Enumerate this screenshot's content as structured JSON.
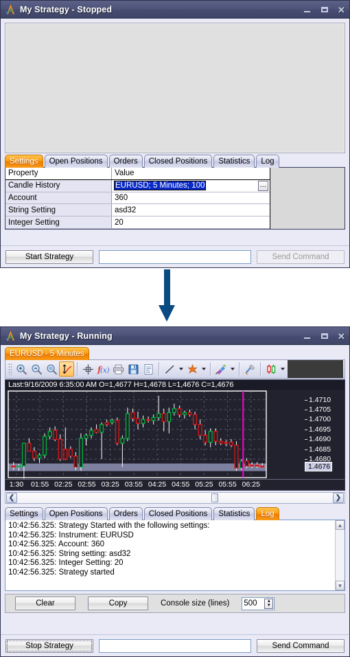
{
  "stopped_window": {
    "title_app": "My Strategy",
    "title_status": " - Stopped",
    "logo_icon": "alpari-a-logo-icon",
    "window_controls": {
      "minimize": "minimize-icon",
      "maximize": "maximize-icon",
      "close": "✕"
    },
    "tabs": [
      {
        "label": "Settings",
        "active": true
      },
      {
        "label": "Open Positions",
        "active": false
      },
      {
        "label": "Orders",
        "active": false
      },
      {
        "label": "Closed Positions",
        "active": false
      },
      {
        "label": "Statistics",
        "active": false
      },
      {
        "label": "Log",
        "active": false
      }
    ],
    "grid": {
      "columns": [
        "Property",
        "Value"
      ],
      "rows": [
        {
          "property": "Candle History",
          "value": "EURUSD; 5 Minutes; 100",
          "selected": true,
          "has_ellipsis": true,
          "ellipsis_label": "…"
        },
        {
          "property": "Account",
          "value": "360",
          "selected": false,
          "has_ellipsis": false
        },
        {
          "property": "String Setting",
          "value": "asd32",
          "selected": false,
          "has_ellipsis": false
        },
        {
          "property": "Integer Setting",
          "value": "20",
          "selected": false,
          "has_ellipsis": false
        }
      ]
    },
    "command_bar": {
      "action_button": "Start Strategy",
      "input_value": "",
      "input_placeholder": "",
      "send_button": "Send Command"
    }
  },
  "arrow": {
    "name": "flow-arrow-down",
    "color": "#0a4a82"
  },
  "running_window": {
    "title_app": "My Strategy",
    "title_status": " - Running",
    "logo_icon": "alpari-a-logo-icon",
    "chart_tab": {
      "label": "EURUSD - 5 Minutes",
      "active": true
    },
    "toolbar": {
      "buttons": [
        {
          "name": "zoom-in-icon",
          "caret": false
        },
        {
          "name": "zoom-out-icon",
          "caret": false
        },
        {
          "name": "zoom-fit-icon",
          "caret": false
        },
        {
          "name": "auto-scale-icon",
          "caret": false,
          "active": true
        },
        {
          "name": "crosshair-icon",
          "caret": false
        },
        {
          "name": "indicator-fx-icon",
          "caret": false
        },
        {
          "name": "print-icon",
          "caret": false
        },
        {
          "name": "save-icon",
          "caret": false
        },
        {
          "name": "report-icon",
          "caret": false
        },
        {
          "name": "line-tool-icon",
          "caret": true
        },
        {
          "name": "delete-objects-icon",
          "caret": true
        },
        {
          "name": "color-scheme-icon",
          "caret": true
        },
        {
          "name": "chart-settings-icon",
          "caret": false
        },
        {
          "name": "candle-type-icon",
          "caret": true
        }
      ]
    },
    "chart_info": "Last:9/16/2009 6:35:00 AM O=1,4677 H=1,4678 L=1,4676 C=1,4676",
    "scrollbar": {
      "left_arrow": "❮",
      "right_arrow": "❯"
    },
    "tabs": [
      {
        "label": "Settings",
        "active": false
      },
      {
        "label": "Open Positions",
        "active": false
      },
      {
        "label": "Orders",
        "active": false
      },
      {
        "label": "Closed Positions",
        "active": false
      },
      {
        "label": "Statistics",
        "active": false
      },
      {
        "label": "Log",
        "active": true
      }
    ],
    "log_lines": [
      "10:42:56.325: Strategy Started with the following settings:",
      "10:42:56.325: Instrument: EURUSD",
      "10:42:56.325: Account: 360",
      "10:42:56.325: String setting: asd32",
      "10:42:56.325: Integer Setting: 20",
      "10:42:56.325: Strategy started"
    ],
    "console_bar": {
      "clear_button": "Clear",
      "copy_button": "Copy",
      "console_size_label": "Console size (lines)",
      "console_size_value": "500",
      "spin_up": "▲",
      "spin_down": "▼"
    },
    "command_bar": {
      "action_button": "Stop Strategy",
      "input_value": "",
      "input_placeholder": "",
      "send_button": "Send Command"
    }
  },
  "chart_data": {
    "type": "candlestick",
    "title": "EURUSD - 5 Minutes",
    "instrument": "EURUSD",
    "timeframe": "5 Minutes",
    "xlabel": "",
    "ylabel": "",
    "grid": true,
    "legend_position": "none",
    "background": "#22222e",
    "up_color": "#00b33c",
    "down_color": "#e01515",
    "wick_color": "#ffffff",
    "cursor_line_color": "#ff00d0",
    "current_price": 1.4676,
    "ylim": [
      1.4672,
      1.4713
    ],
    "price_ticks": [
      1.471,
      1.4705,
      1.47,
      1.4695,
      1.469,
      1.4685,
      1.468
    ],
    "time_ticks": [
      "1:30",
      "01:55",
      "02:25",
      "02:55",
      "03:25",
      "03:55",
      "04:25",
      "04:55",
      "05:25",
      "05:55",
      "06:25"
    ],
    "last_quote": {
      "date": "9/16/2009",
      "time": "6:35:00 AM",
      "open": 1.4677,
      "high": 1.4678,
      "low": 1.4676,
      "close": 1.4676
    },
    "candles": [
      {
        "o": 1.46765,
        "h": 1.46785,
        "l": 1.46745,
        "c": 1.4676,
        "dir": "down"
      },
      {
        "o": 1.4676,
        "h": 1.46775,
        "l": 1.4674,
        "c": 1.46765,
        "dir": "up"
      },
      {
        "o": 1.46765,
        "h": 1.4679,
        "l": 1.467,
        "c": 1.4688,
        "dir": "up"
      },
      {
        "o": 1.4688,
        "h": 1.46905,
        "l": 1.46855,
        "c": 1.4684,
        "dir": "down"
      },
      {
        "o": 1.4684,
        "h": 1.4686,
        "l": 1.4679,
        "c": 1.46805,
        "dir": "down"
      },
      {
        "o": 1.46805,
        "h": 1.4683,
        "l": 1.4678,
        "c": 1.4682,
        "dir": "up"
      },
      {
        "o": 1.4682,
        "h": 1.4693,
        "l": 1.46805,
        "c": 1.46915,
        "dir": "up"
      },
      {
        "o": 1.46915,
        "h": 1.4696,
        "l": 1.469,
        "c": 1.4694,
        "dir": "up"
      },
      {
        "o": 1.46945,
        "h": 1.46965,
        "l": 1.4689,
        "c": 1.469,
        "dir": "down"
      },
      {
        "o": 1.469,
        "h": 1.46925,
        "l": 1.4679,
        "c": 1.468,
        "dir": "down"
      },
      {
        "o": 1.468,
        "h": 1.4696,
        "l": 1.46795,
        "c": 1.4685,
        "dir": "down"
      },
      {
        "o": 1.4685,
        "h": 1.46865,
        "l": 1.46805,
        "c": 1.46815,
        "dir": "down"
      },
      {
        "o": 1.46815,
        "h": 1.46835,
        "l": 1.46745,
        "c": 1.4676,
        "dir": "down"
      },
      {
        "o": 1.4676,
        "h": 1.4693,
        "l": 1.4674,
        "c": 1.46905,
        "dir": "up"
      },
      {
        "o": 1.46905,
        "h": 1.4693,
        "l": 1.4687,
        "c": 1.4692,
        "dir": "up"
      },
      {
        "o": 1.4692,
        "h": 1.4696,
        "l": 1.46905,
        "c": 1.46945,
        "dir": "up"
      },
      {
        "o": 1.4695,
        "h": 1.46975,
        "l": 1.4693,
        "c": 1.46935,
        "dir": "down"
      },
      {
        "o": 1.46935,
        "h": 1.46985,
        "l": 1.468,
        "c": 1.46975,
        "dir": "up"
      },
      {
        "o": 1.46975,
        "h": 1.47,
        "l": 1.46965,
        "c": 1.46985,
        "dir": "down"
      },
      {
        "o": 1.46985,
        "h": 1.47005,
        "l": 1.46975,
        "c": 1.46995,
        "dir": "up"
      },
      {
        "o": 1.46995,
        "h": 1.4701,
        "l": 1.4687,
        "c": 1.4688,
        "dir": "down"
      },
      {
        "o": 1.4688,
        "h": 1.4692,
        "l": 1.4676,
        "c": 1.46905,
        "dir": "up"
      },
      {
        "o": 1.46905,
        "h": 1.4706,
        "l": 1.4689,
        "c": 1.4703,
        "dir": "up"
      },
      {
        "o": 1.47035,
        "h": 1.47055,
        "l": 1.4699,
        "c": 1.47005,
        "dir": "down"
      },
      {
        "o": 1.47005,
        "h": 1.4704,
        "l": 1.4695,
        "c": 1.4698,
        "dir": "down"
      },
      {
        "o": 1.4698,
        "h": 1.4702,
        "l": 1.4696,
        "c": 1.47,
        "dir": "up"
      },
      {
        "o": 1.47,
        "h": 1.47015,
        "l": 1.46985,
        "c": 1.46995,
        "dir": "down"
      },
      {
        "o": 1.46995,
        "h": 1.47025,
        "l": 1.46975,
        "c": 1.4701,
        "dir": "up"
      },
      {
        "o": 1.4701,
        "h": 1.4712,
        "l": 1.46995,
        "c": 1.4703,
        "dir": "up"
      },
      {
        "o": 1.4703,
        "h": 1.47055,
        "l": 1.4694,
        "c": 1.4699,
        "dir": "down"
      },
      {
        "o": 1.4699,
        "h": 1.4706,
        "l": 1.4693,
        "c": 1.47035,
        "dir": "up"
      },
      {
        "o": 1.47035,
        "h": 1.4708,
        "l": 1.4702,
        "c": 1.47055,
        "dir": "up"
      },
      {
        "o": 1.47055,
        "h": 1.4707,
        "l": 1.4701,
        "c": 1.47025,
        "dir": "down"
      },
      {
        "o": 1.47025,
        "h": 1.47045,
        "l": 1.47005,
        "c": 1.47035,
        "dir": "up"
      },
      {
        "o": 1.47035,
        "h": 1.4705,
        "l": 1.47015,
        "c": 1.47025,
        "dir": "down"
      },
      {
        "o": 1.47025,
        "h": 1.4704,
        "l": 1.4695,
        "c": 1.46975,
        "dir": "down"
      },
      {
        "o": 1.46975,
        "h": 1.47,
        "l": 1.469,
        "c": 1.4692,
        "dir": "down"
      },
      {
        "o": 1.4692,
        "h": 1.46945,
        "l": 1.4687,
        "c": 1.46885,
        "dir": "down"
      },
      {
        "o": 1.46885,
        "h": 1.46955,
        "l": 1.4686,
        "c": 1.4694,
        "dir": "up"
      },
      {
        "o": 1.4694,
        "h": 1.46955,
        "l": 1.4687,
        "c": 1.4689,
        "dir": "down"
      },
      {
        "o": 1.4689,
        "h": 1.46905,
        "l": 1.4687,
        "c": 1.4688,
        "dir": "down"
      },
      {
        "o": 1.4688,
        "h": 1.46895,
        "l": 1.46865,
        "c": 1.46885,
        "dir": "down"
      },
      {
        "o": 1.46885,
        "h": 1.469,
        "l": 1.4686,
        "c": 1.4687,
        "dir": "down"
      },
      {
        "o": 1.4687,
        "h": 1.4689,
        "l": 1.4674,
        "c": 1.46755,
        "dir": "down"
      },
      {
        "o": 1.46755,
        "h": 1.468,
        "l": 1.46745,
        "c": 1.4679,
        "dir": "up"
      },
      {
        "o": 1.4679,
        "h": 1.46805,
        "l": 1.46755,
        "c": 1.46765,
        "dir": "down"
      },
      {
        "o": 1.46765,
        "h": 1.46785,
        "l": 1.46755,
        "c": 1.4677,
        "dir": "down"
      },
      {
        "o": 1.4677,
        "h": 1.46785,
        "l": 1.46755,
        "c": 1.46765,
        "dir": "down"
      },
      {
        "o": 1.46765,
        "h": 1.4678,
        "l": 1.4676,
        "c": 1.4676,
        "dir": "down"
      }
    ]
  }
}
